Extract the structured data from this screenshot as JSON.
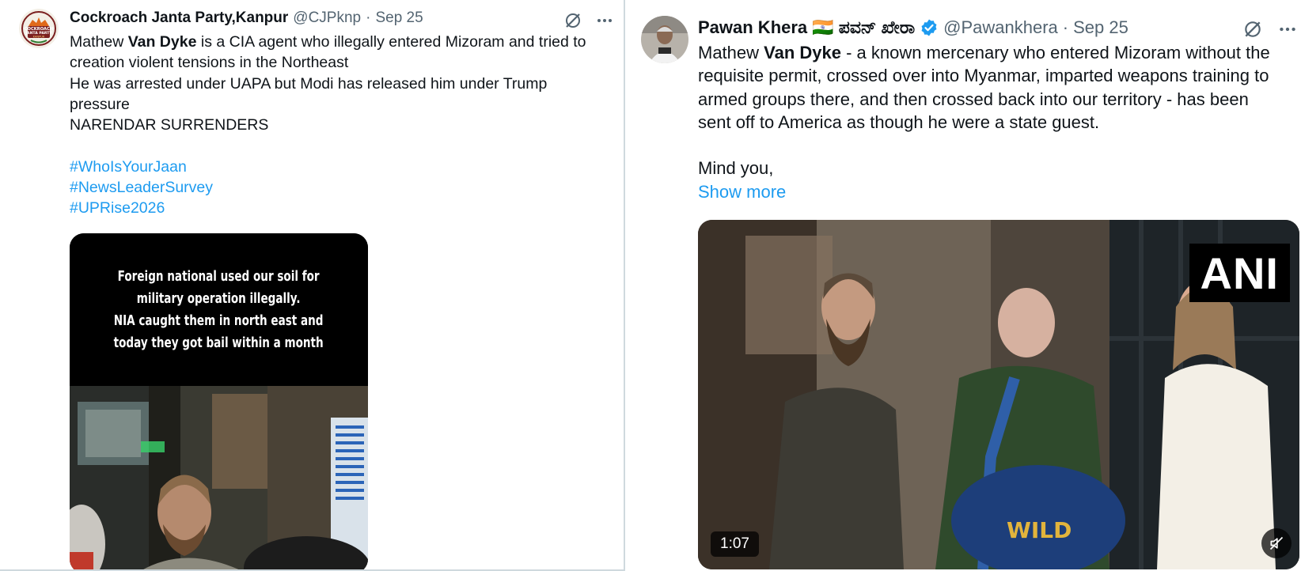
{
  "tweets": [
    {
      "author": {
        "display_name": "Cockroach Janta Party,Kanpur",
        "handle": "@CJPknp",
        "avatar_text": [
          "COCKROACH",
          "JANTA PARTY",
          "KANPUR"
        ]
      },
      "separator": "·",
      "timestamp": "Sep 25",
      "lines": [
        {
          "parts": [
            "Mathew ",
            "Van Dyke",
            " is a CIA agent who illegally entered Mizoram and tried to"
          ]
        },
        {
          "text": "creation violent tensions in the Northeast"
        },
        {
          "text": "He was arrested under UAPA but Modi has released him under Trump"
        },
        {
          "text": "pressure"
        },
        {
          "text": "NARENDAR SURRENDERS"
        }
      ],
      "hashtags": [
        "#WhoIsYourJaan",
        "#NewsLeaderSurvey",
        "#UPRise2026"
      ],
      "media": {
        "type": "image",
        "caption_lines": [
          "Foreign national used our soil for",
          "military operation illegally.",
          "NIA caught them in north east and",
          "today they got bail within a month"
        ]
      },
      "icons": [
        "grok-icon",
        "more-icon"
      ]
    },
    {
      "author": {
        "display_name": "Pawan Khera 🇮🇳 ಪವನ್ ಖೇರಾ",
        "handle": "@Pawankhera",
        "verified": true
      },
      "separator": "·",
      "timestamp": "Sep 25",
      "lines": [
        {
          "parts": [
            "Mathew ",
            "Van Dyke",
            " - a known mercenary who entered Mizoram without the"
          ]
        },
        {
          "text": "requisite permit, crossed over into Myanmar, imparted weapons training to"
        },
        {
          "text": "armed groups there, and then crossed back into our territory - has been"
        },
        {
          "text": "sent off to America as though he were a state guest."
        },
        {
          "text": ""
        },
        {
          "text": "Mind you,"
        }
      ],
      "show_more": "Show more",
      "media": {
        "type": "video",
        "watermark": "ANI",
        "duration": "1:07",
        "bag_text": "WILD"
      },
      "icons": [
        "grok-icon",
        "more-icon",
        "mute-icon"
      ]
    }
  ],
  "colors": {
    "text": "#0f1419",
    "muted": "#536471",
    "link": "#1d9bf0",
    "verified": "#1d9bf0",
    "divider": "#cfd9de"
  }
}
